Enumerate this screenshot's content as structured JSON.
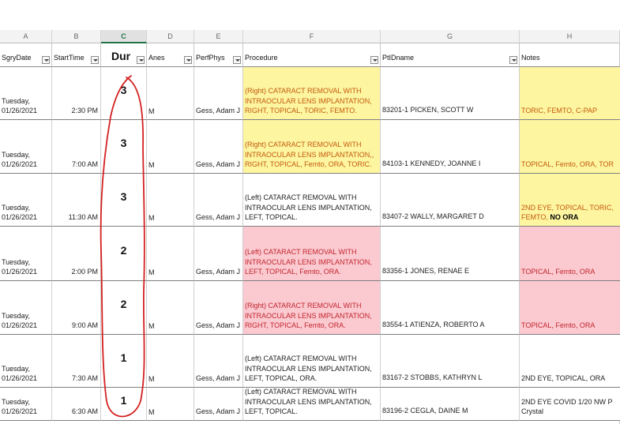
{
  "columns": [
    "A",
    "B",
    "C",
    "D",
    "E",
    "F",
    "G",
    "H"
  ],
  "headers": [
    "SgryDate",
    "StartTime",
    "Dur",
    "Anes",
    "PerfPhys",
    "Procedure",
    "PtIDname",
    "Notes"
  ],
  "rows": [
    {
      "date_day": "Tuesday,",
      "date_value": "01/26/2021",
      "start": "2:30 PM",
      "dur": "3",
      "anes": "M",
      "phys": "Gess, Adam J",
      "procedure": "(Right) CATARACT REMOVAL WITH INTRAOCULAR LENS IMPLANTATION, RIGHT, TOPICAL, TORIC, FEMTO.",
      "patient": "83201-1 PICKEN, SCOTT W",
      "notes": "TORIC, FEMTO, C-PAP",
      "proc_fill": "yellow",
      "proc_text": "orange",
      "notes_fill": "yellow",
      "notes_text": "orange"
    },
    {
      "date_day": "Tuesday,",
      "date_value": "01/26/2021",
      "start": "7:00 AM",
      "dur": "3",
      "anes": "M",
      "phys": "Gess, Adam J",
      "procedure": "(Right) CATARACT REMOVAL WITH INTRAOCULAR LENS IMPLANTATION,, RIGHT, TOPICAL, Femto, ORA, TORIC.",
      "patient": "84103-1 KENNEDY, JOANNE I",
      "notes": "TOPICAL, Femto, ORA, TOR",
      "proc_fill": "yellow",
      "proc_text": "orange",
      "notes_fill": "yellow",
      "notes_text": "orange"
    },
    {
      "date_day": "Tuesday,",
      "date_value": "01/26/2021",
      "start": "11:30 AM",
      "dur": "3",
      "anes": "M",
      "phys": "Gess, Adam J",
      "procedure": "(Left) CATARACT REMOVAL WITH INTRAOCULAR LENS IMPLANTATION, LEFT, TOPICAL.",
      "patient": "83407-2 WALLY, MARGARET D",
      "notes": "2ND EYE, TOPICAL, TORIC, FEMTO,",
      "notes_extra": "NO ORA",
      "proc_fill": "none",
      "proc_text": "default",
      "notes_fill": "yellow",
      "notes_text": "orange"
    },
    {
      "date_day": "Tuesday,",
      "date_value": "01/26/2021",
      "start": "2:00 PM",
      "dur": "2",
      "anes": "M",
      "phys": "Gess, Adam J",
      "procedure": "(Left) CATARACT REMOVAL WITH INTRAOCULAR LENS IMPLANTATION, LEFT, TOPICAL, Femto, ORA.",
      "patient": "83356-1 JONES, RENAE E",
      "notes": "TOPICAL, Femto, ORA",
      "proc_fill": "pink",
      "proc_text": "red",
      "notes_fill": "pink",
      "notes_text": "red"
    },
    {
      "date_day": "Tuesday,",
      "date_value": "01/26/2021",
      "start": "9:00 AM",
      "dur": "2",
      "anes": "M",
      "phys": "Gess, Adam J",
      "procedure": "(Right) CATARACT REMOVAL WITH INTRAOCULAR LENS IMPLANTATION, RIGHT, TOPICAL, Femto, ORA.",
      "patient": "83554-1 ATIENZA, ROBERTO A",
      "notes": "TOPICAL, Femto, ORA",
      "proc_fill": "pink",
      "proc_text": "red",
      "notes_fill": "pink",
      "notes_text": "red"
    },
    {
      "date_day": "Tuesday,",
      "date_value": "01/26/2021",
      "start": "7:30 AM",
      "dur": "1",
      "anes": "M",
      "phys": "Gess, Adam J",
      "procedure": "(Left) CATARACT REMOVAL WITH INTRAOCULAR LENS IMPLANTATION, LEFT, TOPICAL, ORA.",
      "patient": "83167-2 STOBBS, KATHRYN L",
      "notes": "2ND EYE, TOPICAL, ORA",
      "proc_fill": "none",
      "proc_text": "default",
      "notes_fill": "none",
      "notes_text": "default"
    },
    {
      "date_day": "Tuesday,",
      "date_value": "01/26/2021",
      "start": "6:30 AM",
      "dur": "1",
      "anes": "M",
      "phys": "Gess, Adam J",
      "procedure": "(Left) CATARACT REMOVAL WITH INTRAOCULAR LENS IMPLANTATION, LEFT, TOPICAL.",
      "patient": "83196-2 CEGLA, DAINE M",
      "notes": "2ND EYE COVID 1/20 NW P Crystal",
      "proc_fill": "none",
      "proc_text": "default",
      "notes_fill": "none",
      "notes_text": "default"
    }
  ],
  "colors": {
    "highlight_yellow": "#fdf5a0",
    "highlight_pink": "#fbc9d0",
    "text_orange": "#c45a0e",
    "text_red": "#c2262e",
    "circle_annotation": "#d42020",
    "active_column": "#217346"
  }
}
